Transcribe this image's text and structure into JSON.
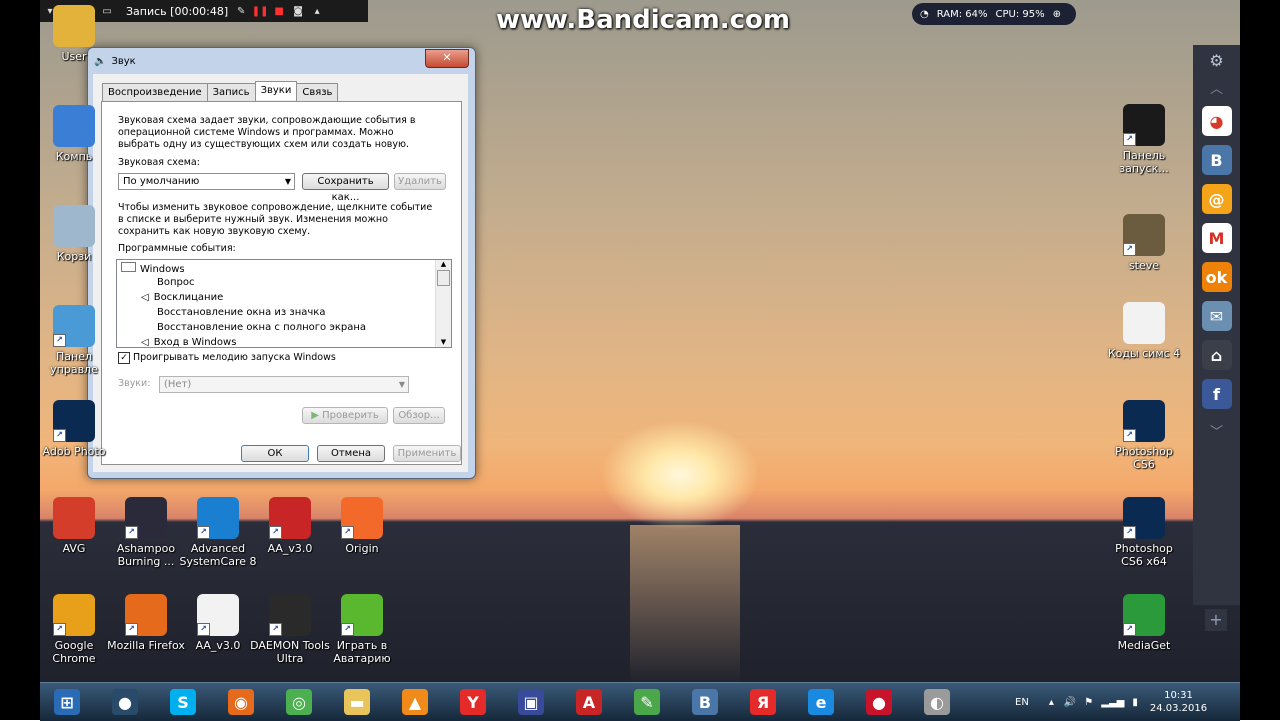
{
  "recorder": {
    "title": "Запись [00:00:48]"
  },
  "watermark": "www.Bandicam.com",
  "sysmon": {
    "ram": "RAM: 64%",
    "cpu": "CPU: 95%"
  },
  "desktop_left": [
    {
      "label": "User",
      "icon": "user-folder-icon",
      "color": "#e2b23a"
    },
    {
      "label": "Компь",
      "icon": "computer-icon",
      "color": "#3a7fd5"
    },
    {
      "label": "Корзи",
      "icon": "recycle-bin-icon",
      "color": "#9fb7cc"
    },
    {
      "label": "Панел управле",
      "icon": "control-panel-icon",
      "color": "#4a9ad6"
    },
    {
      "label": "Adob Photo",
      "icon": "photoshop-icon",
      "color": "#0b2a52"
    }
  ],
  "desktop_row1": [
    {
      "label": "AVG",
      "icon": "avg-icon",
      "color": "#d43d2a"
    },
    {
      "label": "Ashampoo Burning ...",
      "icon": "ashampoo-icon",
      "color": "#2a2a3a"
    },
    {
      "label": "Advanced SystemCare 8",
      "icon": "systemcare-icon",
      "color": "#1a7fd0"
    },
    {
      "label": "AA_v3.0",
      "icon": "aa-icon",
      "color": "#c82626"
    },
    {
      "label": "Origin",
      "icon": "origin-icon",
      "color": "#f2692a"
    }
  ],
  "desktop_row2": [
    {
      "label": "Google Chrome",
      "icon": "chrome-icon",
      "color": "#e8a01b"
    },
    {
      "label": "Mozilla Firefox",
      "icon": "firefox-icon",
      "color": "#e66a1b"
    },
    {
      "label": "AA_v3.0",
      "icon": "text-file-icon",
      "color": "#f2f2f2"
    },
    {
      "label": "DAEMON Tools Ultra",
      "icon": "daemon-tools-icon",
      "color": "#2a2a2a"
    },
    {
      "label": "Играть в Аватарию",
      "icon": "avataria-icon",
      "color": "#5ab82f"
    }
  ],
  "desktop_right": [
    {
      "label": "Панель запуск...",
      "icon": "download-icon",
      "color": "#1a1a1a"
    },
    {
      "label": "steve",
      "icon": "steve-image-icon",
      "color": "#6b5b3f"
    },
    {
      "label": "Коды симс 4",
      "icon": "text-file-icon",
      "color": "#f2f2f2"
    },
    {
      "label": "Photoshop CS6",
      "icon": "photoshop-icon",
      "color": "#0b2a52"
    },
    {
      "label": "Photoshop CS6 x64",
      "icon": "photoshop-icon",
      "color": "#0b2a52"
    },
    {
      "label": "MediaGet",
      "icon": "mediaget-icon",
      "color": "#2a9a3a"
    }
  ],
  "side_panel": [
    {
      "icon": "chrome-store-icon",
      "glyph": "◕",
      "color": "#ffffff",
      "fg": "#d83a2a"
    },
    {
      "icon": "vk-icon",
      "glyph": "В",
      "color": "#4a76a8",
      "fg": "#ffffff"
    },
    {
      "icon": "mail-ru-icon",
      "glyph": "@",
      "color": "#f5a318",
      "fg": "#ffffff"
    },
    {
      "icon": "gmail-icon",
      "glyph": "M",
      "color": "#ffffff",
      "fg": "#d93025"
    },
    {
      "icon": "odnoklassniki-icon",
      "glyph": "ok",
      "color": "#ee8208",
      "fg": "#ffffff"
    },
    {
      "icon": "mail-icon",
      "glyph": "✉",
      "color": "#6b8fb0",
      "fg": "#ffffff"
    },
    {
      "icon": "inbox-icon",
      "glyph": "⌂",
      "color": "#3a3f4a",
      "fg": "#ffffff"
    },
    {
      "icon": "facebook-icon",
      "glyph": "f",
      "color": "#3b5998",
      "fg": "#ffffff"
    }
  ],
  "dialog": {
    "title": "Звук",
    "tabs": [
      "Воспроизведение",
      "Запись",
      "Звуки",
      "Связь"
    ],
    "intro": "Звуковая схема задает звуки, сопровождающие события в операционной системе Windows и программах. Можно выбрать одну из существующих схем или создать новую.",
    "scheme_label": "Звуковая схема:",
    "scheme_value": "По умолчанию",
    "save_as": "Сохранить как...",
    "delete": "Удалить",
    "hint": "Чтобы изменить звуковое сопровождение, щелкните событие в списке и выберите нужный звук. Изменения можно сохранить как новую звуковую схему.",
    "events_label": "Программные события:",
    "events_root": "Windows",
    "events": [
      "Вопрос",
      "Восклицание",
      "Восстановление окна из значка",
      "Восстановление окна с полного экрана",
      "Вход в Windows"
    ],
    "startup_checkbox": "Проигрывать мелодию запуска Windows",
    "sounds_label": "Звуки:",
    "sounds_value": "(Нет)",
    "test": "Проверить",
    "browse": "Обзор...",
    "ok": "ОК",
    "cancel": "Отмена",
    "apply": "Применить"
  },
  "taskbar": {
    "apps": [
      {
        "icon": "start-orb-icon",
        "glyph": "⊞",
        "color": "#2a6bb5"
      },
      {
        "icon": "shield-app-icon",
        "glyph": "●",
        "color": "#2a4a6a"
      },
      {
        "icon": "skype-icon",
        "glyph": "S",
        "color": "#00aff0"
      },
      {
        "icon": "firefox-icon",
        "glyph": "◉",
        "color": "#e66a1b"
      },
      {
        "icon": "chrome-icon",
        "glyph": "◎",
        "color": "#4caf50"
      },
      {
        "icon": "folder-icon",
        "glyph": "▬",
        "color": "#e8c45a"
      },
      {
        "icon": "vlc-icon",
        "glyph": "▲",
        "color": "#f08a1a"
      },
      {
        "icon": "yandex-browser-icon",
        "glyph": "Y",
        "color": "#e52a2a"
      },
      {
        "icon": "floppy-icon",
        "glyph": "▣",
        "color": "#3a4a9a"
      },
      {
        "icon": "aa-icon",
        "glyph": "A",
        "color": "#c82626"
      },
      {
        "icon": "paint-icon",
        "glyph": "✎",
        "color": "#4aa84a"
      },
      {
        "icon": "vk-icon",
        "glyph": "В",
        "color": "#4a76a8"
      },
      {
        "icon": "yandex-icon",
        "glyph": "Я",
        "color": "#e52a2a"
      },
      {
        "icon": "ie-icon",
        "glyph": "e",
        "color": "#1a8ae0"
      },
      {
        "icon": "bandicam-icon",
        "glyph": "●",
        "color": "#c8142a"
      },
      {
        "icon": "speaker-app-icon",
        "glyph": "◐",
        "color": "#9a9a9a"
      }
    ],
    "lang": "EN",
    "time": "10:31",
    "date": "24.03.2016"
  }
}
